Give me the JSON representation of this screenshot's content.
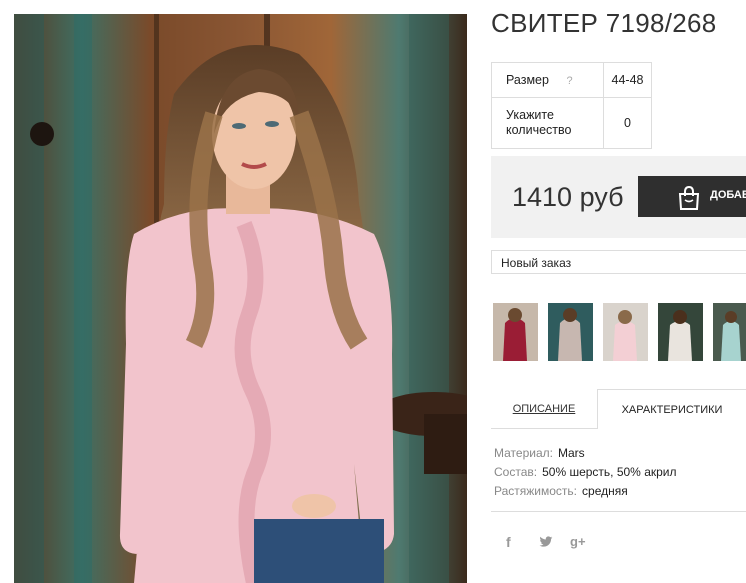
{
  "product": {
    "title": "СВИТЕР 7198/268"
  },
  "options": {
    "size_label": "Размер",
    "size_help": "?",
    "size_value": "44-48",
    "qty_label_line1": "Укажите",
    "qty_label_line2": "количество",
    "qty_value": "0"
  },
  "buy": {
    "price": "1410 руб",
    "add_label": "ДОБАВ",
    "icon": "shopping-bag-icon"
  },
  "order_select": {
    "value": "Новый заказ"
  },
  "thumbnails": [
    {
      "name": "thumb-1"
    },
    {
      "name": "thumb-2"
    },
    {
      "name": "thumb-3"
    },
    {
      "name": "thumb-4"
    },
    {
      "name": "thumb-5"
    }
  ],
  "tabs": {
    "description": "ОПИСАНИЕ",
    "characteristics": "ХАРАКТЕРИСТИКИ"
  },
  "specs": {
    "material_k": "Материал:",
    "material_v": "Mars",
    "composition_k": "Состав:",
    "composition_v": "50% шерсть, 50% акрил",
    "stretch_k": "Растяжимость:",
    "stretch_v": "средняя"
  },
  "social": {
    "facebook": "f",
    "twitter": "twitter-icon",
    "googleplus": "g+"
  },
  "colors": {
    "button_bg": "#2f2f2f",
    "buybox_bg": "#f1f1f1",
    "sweater_pink": "#f2c4cc"
  }
}
